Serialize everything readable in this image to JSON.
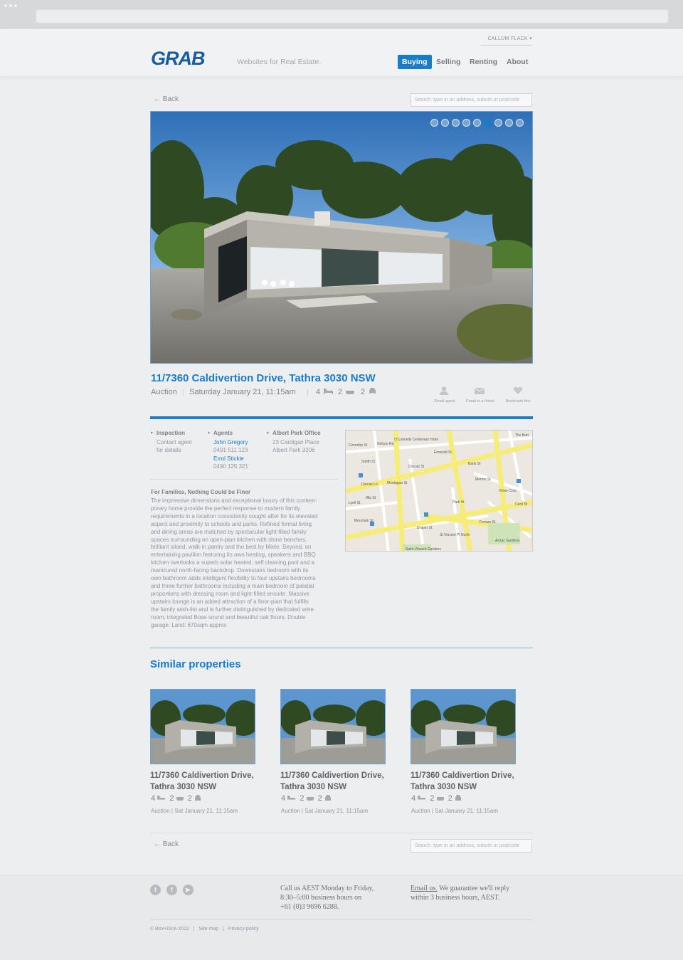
{
  "header": {
    "user_name": "CALLUM FLACK ▾",
    "logo": "GRAB",
    "tagline": "Websites for Real Estate.",
    "nav": [
      "Buying",
      "Selling",
      "Renting",
      "About"
    ]
  },
  "search": {
    "back_label": "Back",
    "placeholder": "Search: type in an address, suburb or postcode"
  },
  "carousel": {
    "total": 9,
    "active_index": 5
  },
  "listing": {
    "address": "11/7360 Caldivertion Drive, Tathra 3030 NSW",
    "sale_type": "Auction",
    "date": "Saturday January 21, 11:15am",
    "bedrooms": "4",
    "bathrooms": "2",
    "cars": "2",
    "actions": [
      "Email agent",
      "Email to a friend",
      "Bookmark this"
    ],
    "inspection_title": "Inspection",
    "inspection_text": [
      "Contact agent",
      "for details"
    ],
    "agents_title": "Agents",
    "agents": [
      {
        "name": "John Gregory",
        "phone": "0491 511 123"
      },
      {
        "name": "Errol Stickie",
        "phone": "0490 125 321"
      }
    ],
    "office_title": "Albert Park Office",
    "office_address": [
      "23 Cardigan Place",
      "Albert Park 3206"
    ],
    "desc_title": "For Families, Nothing Could be Finer",
    "desc_lines": [
      "The impressive dimensions and exceptional luxury of this contem-",
      "porary home provide the perfect response to modern family",
      "requirements in a location consistently sought after for its elevated",
      "aspect and proximity to schools and parks. Refined formal living",
      "and dining areas are matched by spectacular light-filled family",
      "spaces surrounding an open-plan kitchen with stone benches,",
      "brilliant island, walk-in pantry and the best by Miele. Beyond, an",
      "entertaining pavilion featuring its own heating, speakers and BBQ",
      "kitchen overlooks a superb solar heated, self cleaning pool and a",
      "manicured north-facing backdrop. Downstairs bedroom with its",
      "own bathroom adds intelligent flexibility to four upstairs bedrooms",
      "and three further bathrooms including a main bedroom of palatial",
      "proportions with dressing room and light-filled ensuite. Massive",
      "upstairs lounge is an added attraction of a floor-plan that fulfills",
      "the family wish-list and is further distinguished by dedicated wine",
      "room, integrated Bose sound and beautiful oak floors. Double",
      "garage. Land: 670sqm approx"
    ]
  },
  "map_labels": {
    "streets": [
      "Dorcas St",
      "Bank St",
      "Emerald St",
      "Park St",
      "Coventry St",
      "Nelson Rd",
      "Smith St",
      "Montague St",
      "Ferrars St",
      "Draper St",
      "St Vincent Pl North",
      "Howe Cres",
      "Cecil St",
      "Dorcas Ln",
      "Lyell St",
      "Mountain St",
      "Iffla St",
      "Merton St"
    ],
    "places": [
      "The Butt",
      "O'Connells Centenary Hotel",
      "Anzac Gardens",
      "Saint Vincent Gardens"
    ]
  },
  "similar": {
    "title": "Similar properties",
    "items": [
      {
        "title_1": "11/7360 Caldivertion Drive,",
        "title_2": "Tathra 3030 NSW",
        "beds": "4",
        "baths": "2",
        "cars": "2",
        "meta": "Auction  |  Sat January 21, 11:15am"
      },
      {
        "title_1": "11/7360 Caldivertion Drive,",
        "title_2": "Tathra 3030 NSW",
        "beds": "4",
        "baths": "2",
        "cars": "2",
        "meta": "Auction  |  Sat January 21, 11:15am"
      },
      {
        "title_1": "11/7360 Caldivertion Drive,",
        "title_2": "Tathra 3030 NSW",
        "beds": "4",
        "baths": "2",
        "cars": "2",
        "meta": "Auction  |  Sat January 21, 11:15am"
      }
    ]
  },
  "footer": {
    "contact_lines": [
      "Call us AEST Monday to Friday,",
      "8:30–5:00 business hours on",
      "+61 (0)3 9696 6288."
    ],
    "email_link": "Email us.",
    "email_rest": " We guarantee we'll reply",
    "email_line2": "within 3 business hours, AEST.",
    "copyright": "© Box+Dice 2012",
    "sitemap": "Site map",
    "privacy": "Privacy policy",
    "social": [
      "twitter-icon",
      "facebook-icon",
      "youtube-icon"
    ]
  },
  "colors": {
    "accent": "#1a7bc8",
    "background": "#eceef0",
    "logo": "#175da0"
  }
}
